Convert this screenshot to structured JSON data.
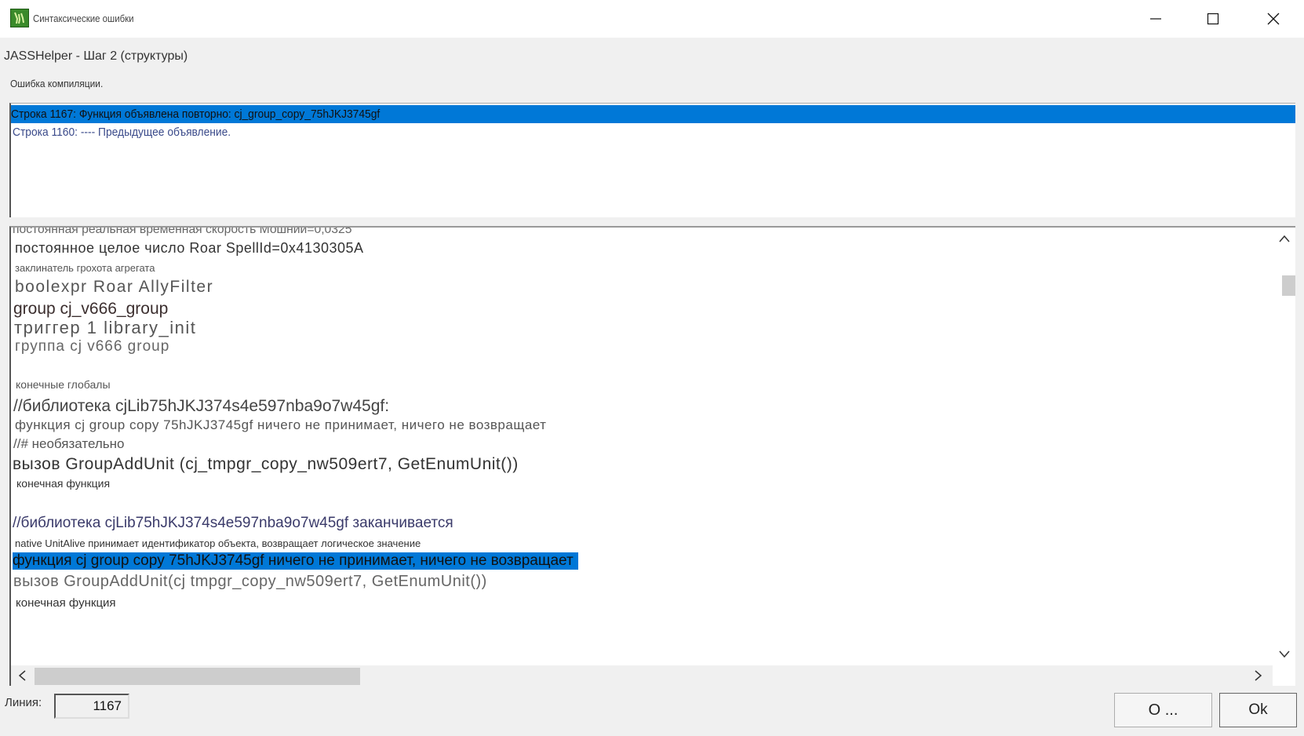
{
  "window": {
    "title": "Синтаксические ошибки",
    "minimize_icon": "minimize-icon",
    "maximize_icon": "maximize-icon",
    "close_icon": "close-icon"
  },
  "header": {
    "step_label": "JASSHelper - Шаг 2 (структуры)",
    "status_label": "Ошибка компиляции."
  },
  "errors": [
    "Строка 1167: Функция объявлена повторно: cj_group_copy_75hJKJ3745gf",
    "Строка 1160: ---- Предыдущее объявление."
  ],
  "code_lines": [
    "постоянная реальная временная скорость Мошний=0,0325",
    "постоянное целое число Roar SpellId=0x4130305A",
    "заклинатель грохота агрегата",
    "boolexpr Roar AllyFilter",
    "group cj_v666_group",
    "триггер 1 library_init",
    "группа cj v666 group",
    "конечные глобалы",
    "//библиотека cjLib75hJKJ374s4e597nba9o7w45gf:",
    "функция cj group copy 75hJKJ3745gf ничего не принимает, ничего не возвращает",
    "//# необязательно",
    "вызов GroupAddUnit (cj_tmpgr_copy_nw509ert7, GetEnumUnit())",
    "конечная функция",
    "//библиотека cjLib75hJKJ374s4e597nba9o7w45gf заканчивается",
    "native UnitAlive принимает идентификатор объекта, возвращает логическое значение",
    "функция cj group copy 75hJKJ3745gf ничего не принимает, ничего не возвращает",
    "вызов GroupAddUnit(cj tmpgr_copy_nw509ert7, GetEnumUnit())",
    "конечная функция"
  ],
  "footer": {
    "line_label": "Линия:",
    "line_value": "1167",
    "about_button": "О ...",
    "ok_button": "Ok"
  },
  "colors": {
    "selection": "#0078d7",
    "error_text": "#3a4a8a"
  }
}
